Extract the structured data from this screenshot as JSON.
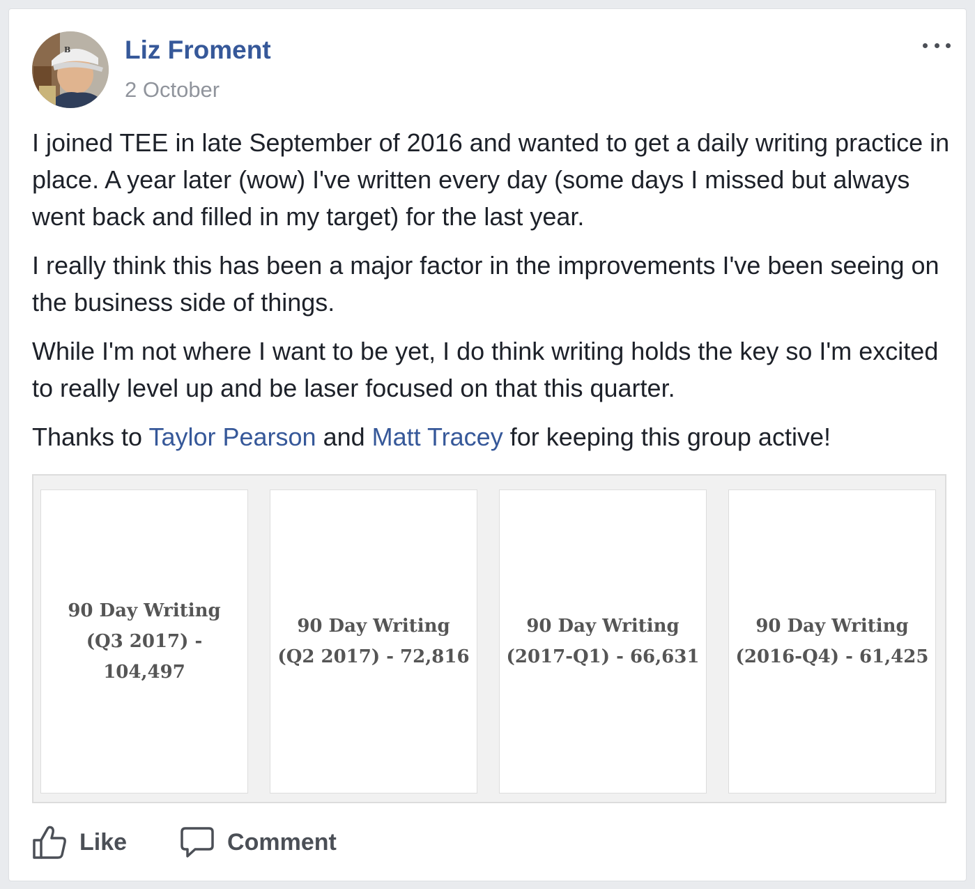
{
  "post": {
    "author": "Liz Froment",
    "date": "2 October",
    "paragraphs": [
      "I joined TEE in late September of 2016 and wanted to get a daily writing practice in place. A year later (wow) I've written every day (some days I missed but always went back and filled in my target) for the last year.",
      "I really think this has been a major factor in the improvements I've been seeing on the business side of things.",
      "While I'm not where I want to be yet, I do think writing holds the key so I'm excited to really level up and be laser focused on that this quarter."
    ],
    "thanks": {
      "before": "Thanks to ",
      "mention1": "Taylor Pearson",
      "middle": " and ",
      "mention2": "Matt Tracey",
      "after": " for keeping this group active!"
    },
    "attachments": [
      "90 Day Writing (Q3 2017) - 104,497",
      "90 Day Writing (Q2 2017) - 72,816",
      "90 Day Writing (2017-Q1) - 66,631",
      "90 Day Writing (2016-Q4) - 61,425"
    ]
  },
  "actions": {
    "like_label": "Like",
    "comment_label": "Comment"
  },
  "icons": {
    "avatar": "profile-photo",
    "more": "more-options-icon",
    "like": "thumbs-up-icon",
    "comment": "speech-bubble-icon"
  },
  "colors": {
    "link": "#365899",
    "text": "#1d2129",
    "meta": "#90949c"
  }
}
